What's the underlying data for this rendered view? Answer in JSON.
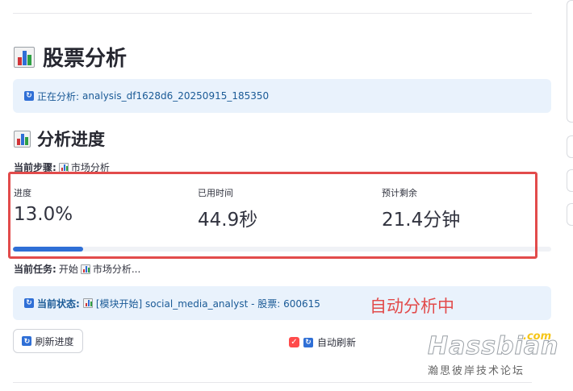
{
  "page": {
    "title": "股票分析"
  },
  "analysis_banner": {
    "label": "正在分析:",
    "value": "analysis_df1628d6_20250915_185350"
  },
  "progress_section": {
    "title": "分析进度",
    "current_step_label": "当前步骤:",
    "current_step_value": "市场分析",
    "metrics": [
      {
        "label": "进度",
        "value": "13.0%"
      },
      {
        "label": "已用时间",
        "value": "44.9秒"
      },
      {
        "label": "预计剩余",
        "value": "21.4分钟"
      }
    ],
    "progress_fraction": 0.13,
    "current_task_label": "当前任务:",
    "current_task_prefix": "开始",
    "current_task_value": "市场分析..."
  },
  "status_banner": {
    "label": "当前状态:",
    "value": "[模块开始] social_media_analyst - 股票: 600615"
  },
  "annotation": "自动分析中",
  "controls": {
    "refresh_button": "刷新进度",
    "auto_refresh_label": "自动刷新",
    "auto_refresh_checked": true
  },
  "watermark": {
    "brand": "Hassbian",
    "com": ".com",
    "sub": "瀚思彼岸技术论坛"
  },
  "colors": {
    "accent_blue": "#2f6fd6",
    "annotation_red": "#e24b4b",
    "info_bg": "#e9f2fc",
    "info_text": "#1a5a96",
    "checkbox_red": "#ff4b4b"
  },
  "icons": {
    "title_icon": "bar-chart-icon",
    "banner_icon": "refresh-icon"
  }
}
